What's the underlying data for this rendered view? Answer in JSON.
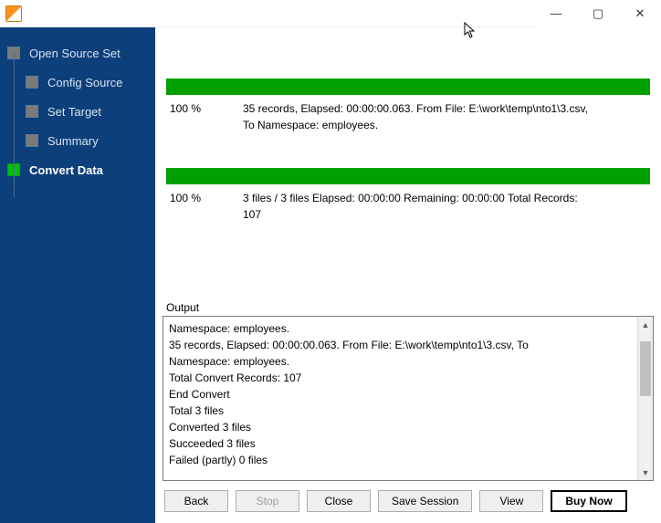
{
  "titlebar": {
    "min": "—",
    "max": "▢",
    "close": "✕"
  },
  "sidebar": {
    "steps": [
      {
        "label": "Open Source Set",
        "sub": false,
        "active": false
      },
      {
        "label": "Config Source",
        "sub": true,
        "active": false
      },
      {
        "label": "Set Target",
        "sub": true,
        "active": false
      },
      {
        "label": "Summary",
        "sub": true,
        "active": false
      },
      {
        "label": "Convert Data",
        "sub": false,
        "active": true
      }
    ]
  },
  "progress1": {
    "percent": "100 %",
    "line1": "35 records,    Elapsed: 00:00:00.063.    From File: E:\\work\\temp\\nto1\\3.csv,",
    "line2": "To Namespace: employees."
  },
  "progress2": {
    "percent": "100 %",
    "line1": "3 files / 3 files    Elapsed: 00:00:00    Remaining: 00:00:00    Total Records:",
    "line2": "107"
  },
  "output": {
    "label": "Output",
    "lines": [
      "Namespace: employees.",
      "35 records,    Elapsed: 00:00:00.063.    From File: E:\\work\\temp\\nto1\\3.csv,    To",
      "Namespace: employees.",
      "Total Convert Records: 107",
      "End Convert",
      "Total 3 files",
      "Converted 3 files",
      "Succeeded 3 files",
      "Failed (partly) 0 files"
    ]
  },
  "buttons": {
    "back": "Back",
    "stop": "Stop",
    "close": "Close",
    "save_session": "Save Session",
    "view": "View",
    "buy_now": "Buy Now"
  }
}
